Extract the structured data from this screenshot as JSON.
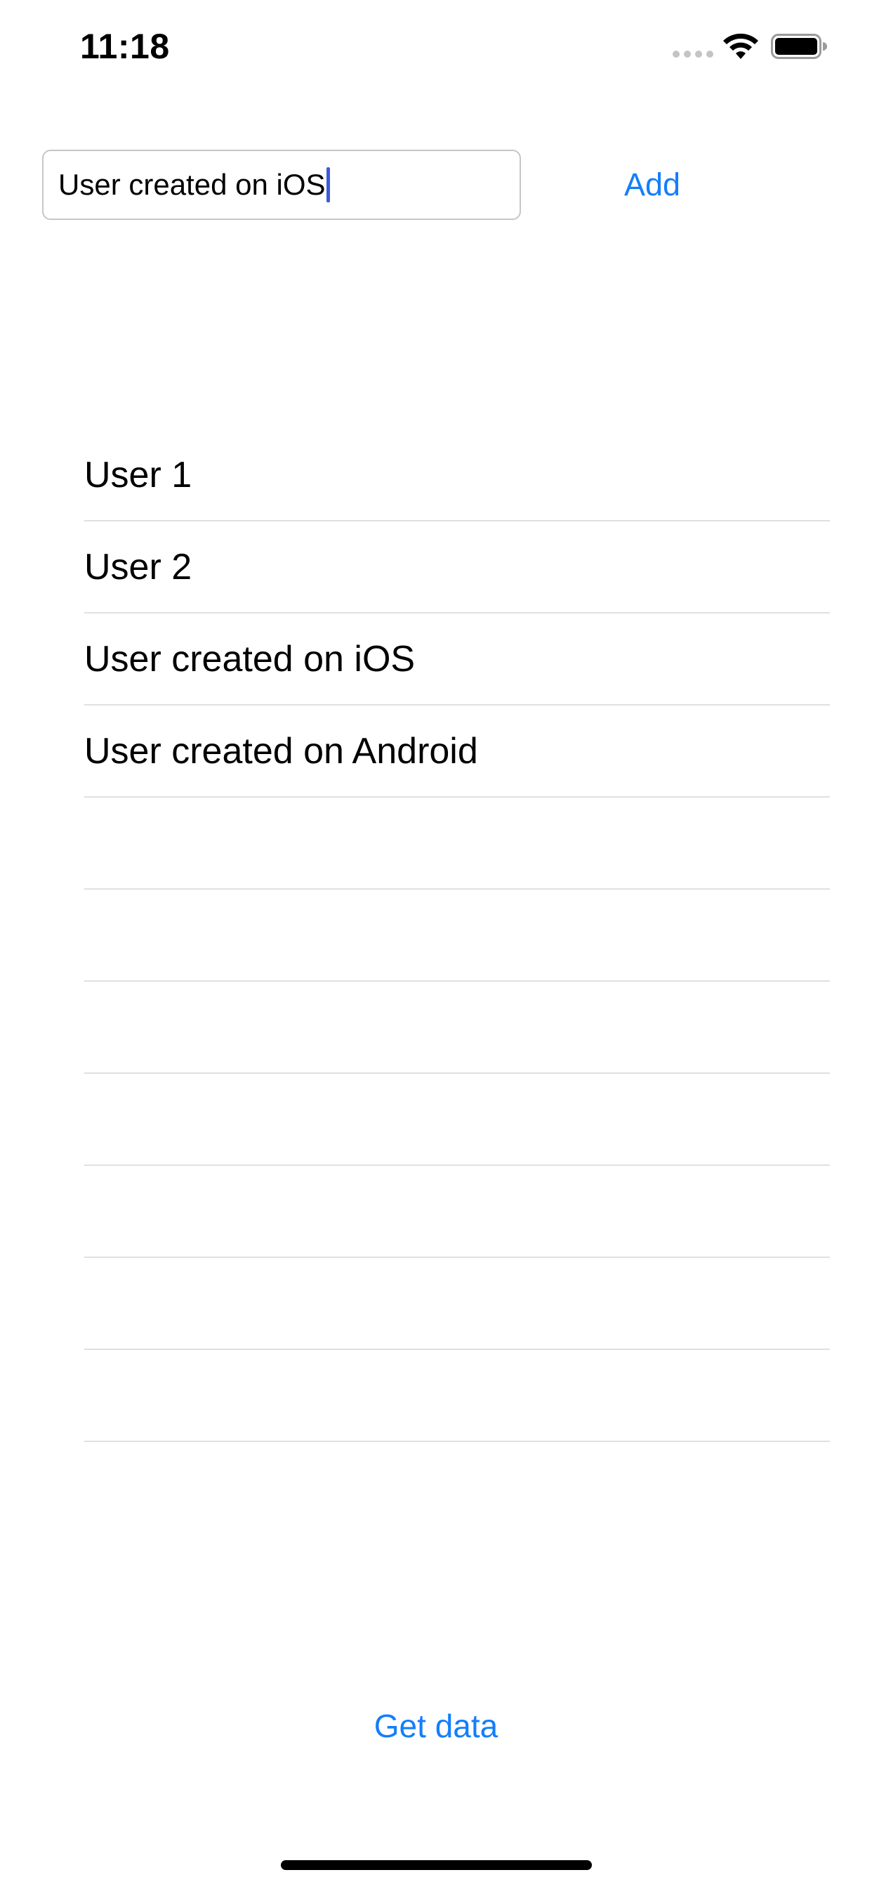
{
  "status_bar": {
    "time": "11:18",
    "signal_icon": "signal-dots-icon",
    "wifi_icon": "wifi-icon",
    "battery_icon": "battery-icon"
  },
  "form": {
    "input_value": "User created on iOS",
    "input_placeholder": "",
    "add_label": "Add"
  },
  "users": {
    "items": [
      {
        "label": "User 1"
      },
      {
        "label": "User 2"
      },
      {
        "label": "User created on iOS"
      },
      {
        "label": "User created on Android"
      },
      {
        "label": ""
      },
      {
        "label": ""
      },
      {
        "label": ""
      },
      {
        "label": ""
      },
      {
        "label": ""
      },
      {
        "label": ""
      },
      {
        "label": ""
      }
    ]
  },
  "footer": {
    "get_data_label": "Get data"
  },
  "colors": {
    "accent": "#147efb",
    "caret": "#3b5bdb",
    "separator": "#e0e0e3",
    "input_border": "#c6c6c8"
  }
}
